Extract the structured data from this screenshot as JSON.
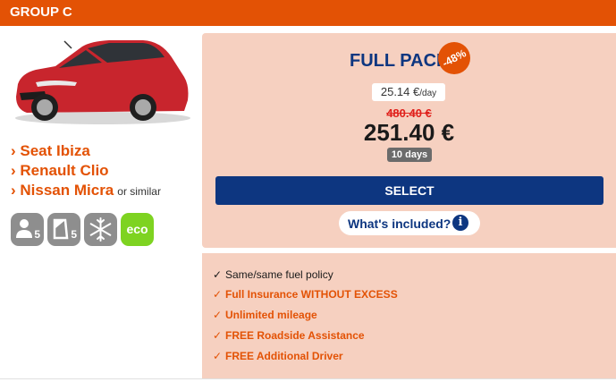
{
  "header": {
    "title": "GROUP C"
  },
  "car": {
    "models": [
      "› Seat Ibiza",
      "› Renault Clio",
      "› Nissan Micra"
    ],
    "similar_text": "or similar",
    "features": {
      "seats": "5",
      "doors": "5",
      "eco": "eco"
    }
  },
  "offer": {
    "pack_name": "FULL PACK",
    "discount": "-48%",
    "price_per_day": "25.14 €",
    "per_day_suffix": "/day",
    "old_price": "480.40 €",
    "total_price": "251.40 €",
    "duration": "10 days",
    "select_label": "SELECT",
    "included_label": "What's included?",
    "info_glyph": "i"
  },
  "inclusions": [
    {
      "check": "✓",
      "text": "Same/same fuel policy"
    },
    {
      "check": "✓",
      "text": "Full Insurance WITHOUT EXCESS"
    },
    {
      "check": "✓",
      "text": "Unlimited mileage"
    },
    {
      "check": "✓",
      "text": "FREE Roadside Assistance"
    },
    {
      "check": "✓",
      "text": "FREE Additional Driver"
    }
  ],
  "colors": {
    "accent_orange": "#e35205",
    "navy": "#0d3680",
    "panel_bg": "#f6d0c0",
    "eco_green": "#7ed321",
    "old_price_red": "#e0201b"
  },
  "icons": {
    "seats": "person-icon",
    "doors": "car-door-icon",
    "ac": "snowflake-icon",
    "info": "info-icon"
  }
}
